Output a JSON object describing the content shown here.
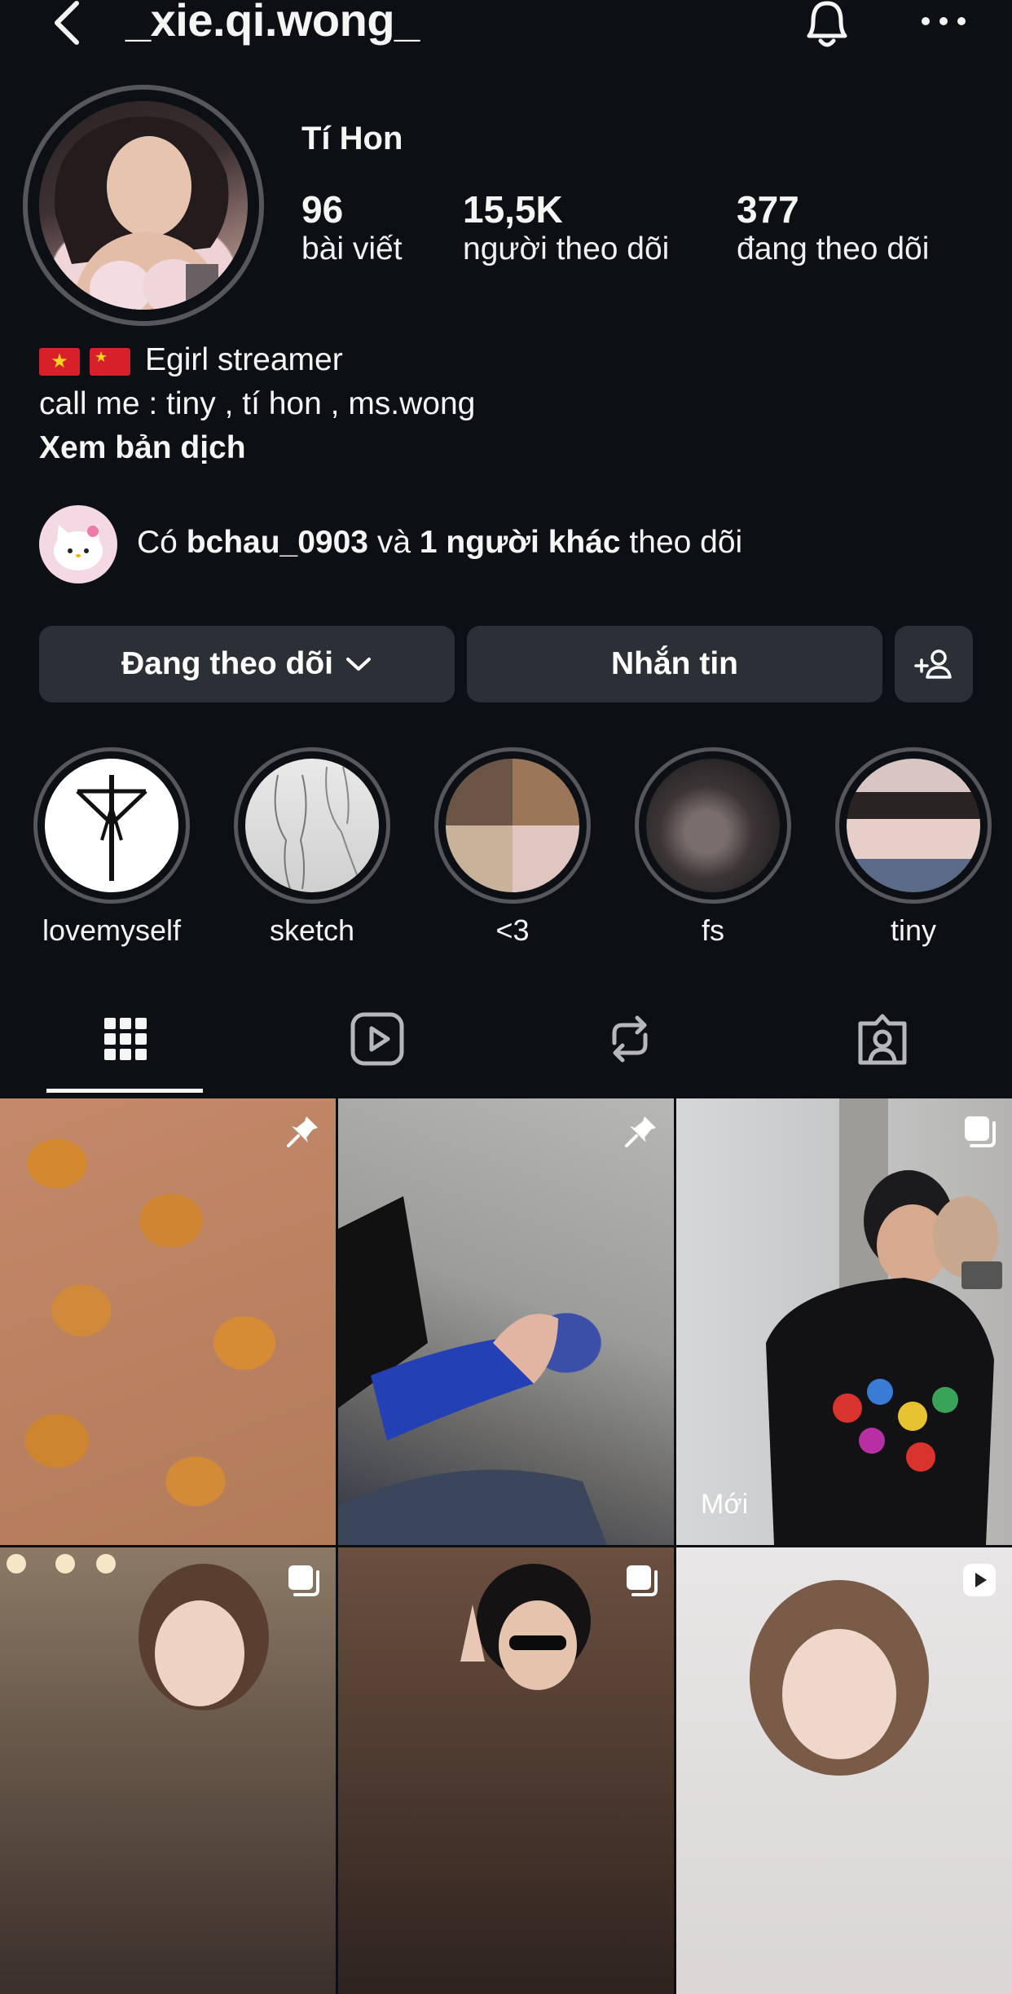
{
  "header": {
    "username": "_xie.qi.wong_",
    "back_icon": "chevron-left-icon",
    "bell_icon": "bell-icon",
    "more_icon": "more-horizontal-icon"
  },
  "profile": {
    "display_name": "Tí Hon",
    "stats": [
      {
        "value": "96",
        "label": "bài viết"
      },
      {
        "value": "15,5K",
        "label": "người theo dõi"
      },
      {
        "value": "377",
        "label": "đang theo dõi"
      }
    ],
    "bio_line1": "Egirl streamer",
    "bio_line2": "call me : tiny , tí hon , ms.wong",
    "translate_link": "Xem bản dịch"
  },
  "mutual": {
    "prefix": "Có ",
    "user": "bchau_0903",
    "middle": " và ",
    "others": "1 người khác",
    "suffix": " theo dõi"
  },
  "actions": {
    "following_label": "Đang theo dõi",
    "message_label": "Nhắn tin",
    "add_user_icon": "add-person-icon"
  },
  "highlights": [
    {
      "label": "lovemyself"
    },
    {
      "label": "sketch"
    },
    {
      "label": "<3"
    },
    {
      "label": "fs"
    },
    {
      "label": "tiny"
    }
  ],
  "tabs": [
    {
      "icon": "grid-icon",
      "active": true
    },
    {
      "icon": "reels-icon",
      "active": false
    },
    {
      "icon": "repost-icon",
      "active": false
    },
    {
      "icon": "tagged-icon",
      "active": false
    }
  ],
  "grid": {
    "new_label": "Mới",
    "items": [
      {
        "badge": "pin-icon"
      },
      {
        "badge": "pin-icon"
      },
      {
        "badge": "carousel-icon",
        "label": "Mới"
      },
      {
        "badge": "carousel-icon"
      },
      {
        "badge": "carousel-icon"
      },
      {
        "badge": "reel-icon"
      }
    ]
  },
  "colors": {
    "background": "#0c1015",
    "button": "#2b2f36",
    "ring": "#55575d",
    "text": "#f5f5f5"
  }
}
